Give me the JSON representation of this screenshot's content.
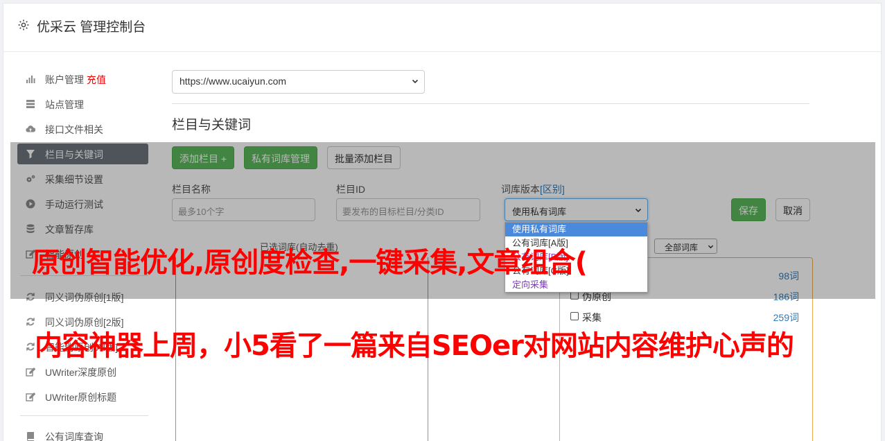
{
  "header": {
    "title": "优采云 管理控制台"
  },
  "sidebar": {
    "items": [
      {
        "label": "账户管理",
        "extra": "充值",
        "icon": "bar-chart-icon"
      },
      {
        "label": "站点管理",
        "icon": "server-icon"
      },
      {
        "label": "接口文件相关",
        "icon": "cloud-upload-icon"
      },
      {
        "label": "栏目与关键词",
        "icon": "filter-icon",
        "active": true
      },
      {
        "label": "采集细节设置",
        "icon": "cogs-icon"
      },
      {
        "label": "手动运行测试",
        "icon": "play-icon"
      },
      {
        "label": "文章暂存库",
        "icon": "database-icon"
      },
      {
        "label": "智能原创",
        "icon": "edit-icon"
      },
      {
        "label": "同义词伪原创[1版]",
        "icon": "refresh-icon"
      },
      {
        "label": "同义词伪原创[2版]",
        "icon": "refresh-icon"
      },
      {
        "label": "智能伪原创[AI版]",
        "icon": "refresh-icon"
      },
      {
        "label": "UWriter深度原创",
        "icon": "edit-icon"
      },
      {
        "label": "UWriter原创标题",
        "icon": "edit-icon"
      },
      {
        "label": "公有词库查询",
        "icon": "book-icon"
      }
    ]
  },
  "main": {
    "site_select": "https://www.ucaiyun.com",
    "section_title": "栏目与关键词",
    "buttons": {
      "add_column": "添加栏目 +",
      "private_lib": "私有词库管理",
      "batch_add": "批量添加栏目",
      "save": "保存",
      "cancel": "取消"
    },
    "fields": {
      "column_name_label": "栏目名称",
      "column_name_placeholder": "最多10个字",
      "column_id_label": "栏目ID",
      "column_id_placeholder": "要发布的目标栏目/分类ID",
      "lib_version_label": "词库版本",
      "lib_version_link": "[区别]",
      "lib_version_value": "使用私有词库"
    },
    "selected_words_label": "已选词库(自动去重)",
    "all_libs_select": "全部词库",
    "dropdown_options": [
      "使用私有词库",
      "公有词库[A版]",
      "公有词库[B版]",
      "公有词库[C版]",
      "定向采集"
    ],
    "libs": [
      {
        "name": "",
        "count": "98词"
      },
      {
        "name": "伪原创",
        "count": "186词"
      },
      {
        "name": "采集",
        "count": "259词"
      }
    ]
  },
  "overlay_text": {
    "line1": "原创智能优化,原创度检查,一键采集,文章组合(",
    "line2": "内容神器上周，小5看了一篇来自SEOer对网站内容维护心声的"
  }
}
